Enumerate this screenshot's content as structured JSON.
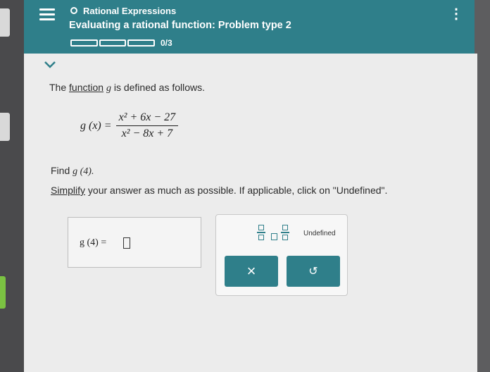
{
  "header": {
    "topic": "Rational Expressions",
    "subtitle": "Evaluating a rational function: Problem type 2",
    "progress": "0/3",
    "progress_fraction": 0
  },
  "problem": {
    "intro_prefix": "The ",
    "intro_link": "function",
    "intro_var": "g",
    "intro_suffix": " is defined as follows.",
    "formula_lhs": "g (x) =",
    "numerator": "x² + 6x − 27",
    "denominator": "x² − 8x + 7",
    "find_prefix": "Find ",
    "find_expr": "g (4).",
    "instruction_link": "Simplify",
    "instruction_rest": " your answer as much as possible. If applicable, click on \"Undefined\"."
  },
  "answer": {
    "label": "g (4)  =",
    "value": ""
  },
  "keypad": {
    "undefined_label": "Undefined",
    "clear_symbol": "×",
    "undo_symbol": "↺"
  },
  "colors": {
    "accent": "#2f7f8a",
    "panel": "#ececec"
  }
}
